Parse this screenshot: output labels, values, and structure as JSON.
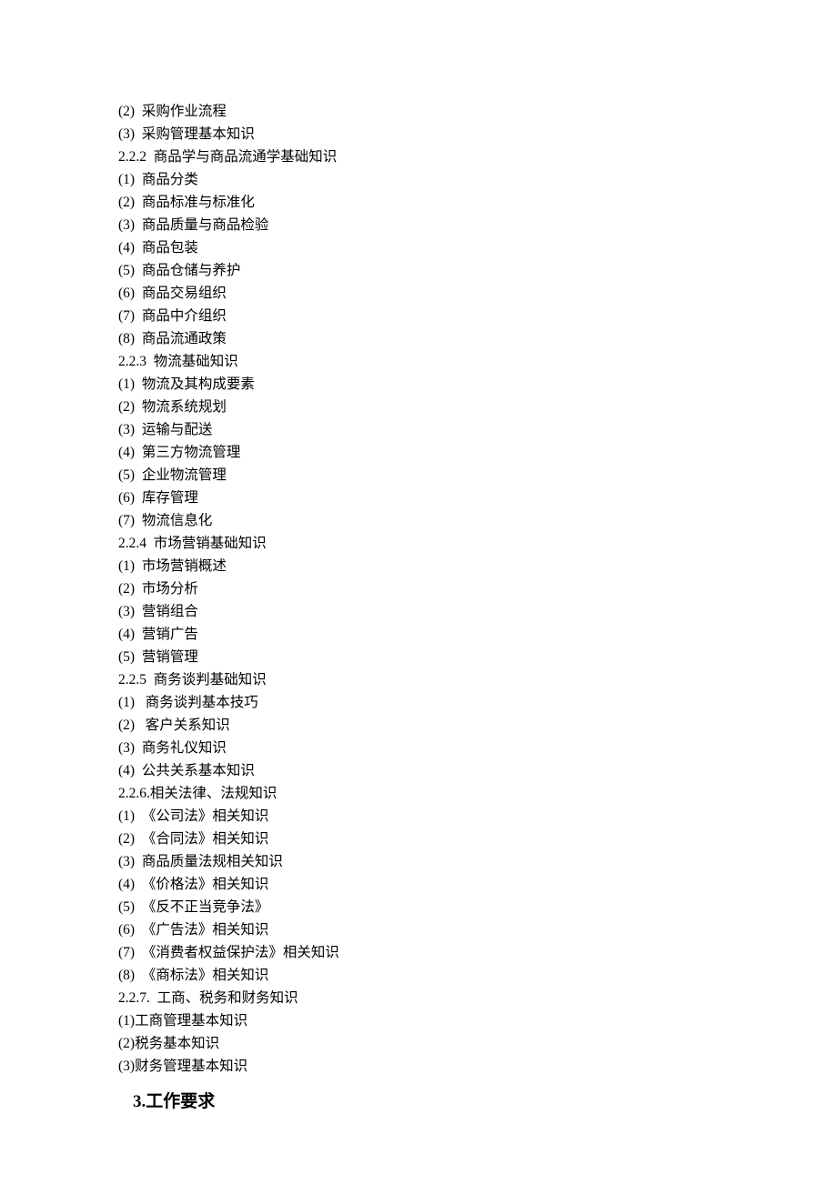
{
  "items": [
    "(2)  采购作业流程",
    "(3)  采购管理基本知识",
    "2.2.2  商品学与商品流通学基础知识",
    "(1)  商品分类",
    "(2)  商品标准与标准化",
    "(3)  商品质量与商品检验",
    "(4)  商品包装",
    "(5)  商品仓储与养护",
    "(6)  商品交易组织",
    "(7)  商品中介组织",
    "(8)  商品流通政策",
    "2.2.3  物流基础知识",
    "(1)  物流及其构成要素",
    "(2)  物流系统规划",
    "(3)  运输与配送",
    "(4)  第三方物流管理",
    "(5)  企业物流管理",
    "(6)  库存管理",
    "(7)  物流信息化",
    "2.2.4  市场营销基础知识",
    "(1)  市场营销概述",
    "(2)  市场分析",
    "(3)  营销组合",
    "(4)  营销广告",
    "(5)  营销管理",
    "2.2.5  商务谈判基础知识",
    "(1)   商务谈判基本技巧",
    "(2)   客户关系知识",
    "(3)  商务礼仪知识",
    "(4)  公共关系基本知识",
    "2.2.6.相关法律、法规知识",
    "(1)  《公司法》相关知识",
    "(2)  《合同法》相关知识",
    "(3)  商品质量法规相关知识",
    "(4)  《价格法》相关知识",
    "(5)  《反不正当竞争法》",
    "(6)  《广告法》相关知识",
    "(7)  《消费者权益保护法》相关知识",
    "(8)  《商标法》相关知识",
    "2.2.7.  工商、税务和财务知识",
    "(1)工商管理基本知识",
    "(2)税务基本知识",
    "(3)财务管理基本知识"
  ],
  "heading": "3.工作要求"
}
